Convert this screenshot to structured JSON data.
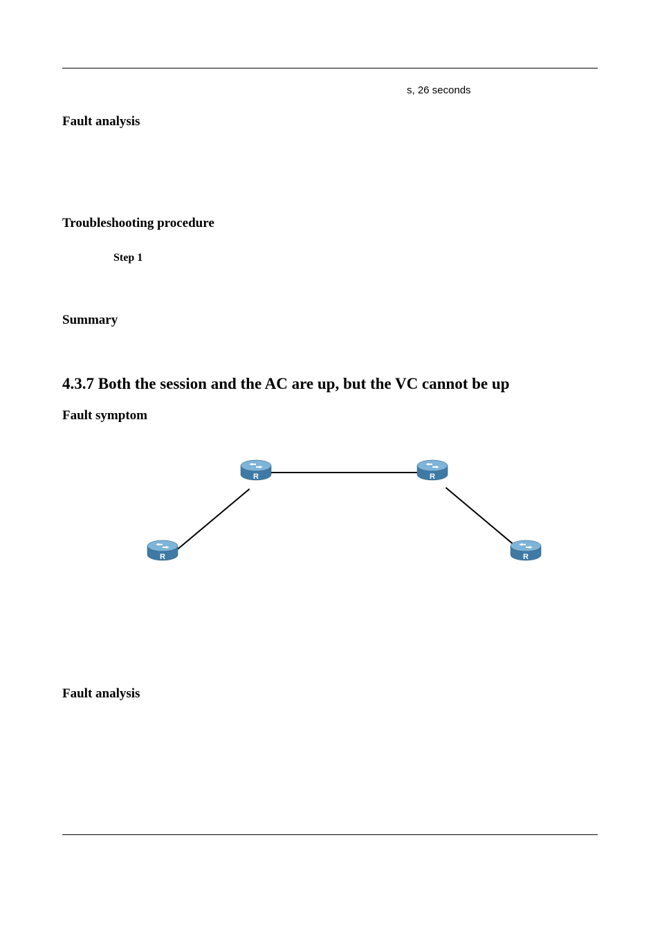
{
  "codeFragment": "s, 26 seconds",
  "headings": {
    "faultAnalysis1": "Fault analysis",
    "troubleshooting": "Troubleshooting procedure",
    "step1": "Step 1",
    "summary": "Summary",
    "section": "4.3.7 Both the session and the AC are up, but the VC cannot be up",
    "faultSymptom": "Fault symptom",
    "faultAnalysis2": "Fault analysis"
  },
  "routers": {
    "topLeft": {
      "label": "R"
    },
    "topRight": {
      "label": "R"
    },
    "bottomLeft": {
      "label": "R"
    },
    "bottomRight": {
      "label": "R"
    }
  }
}
